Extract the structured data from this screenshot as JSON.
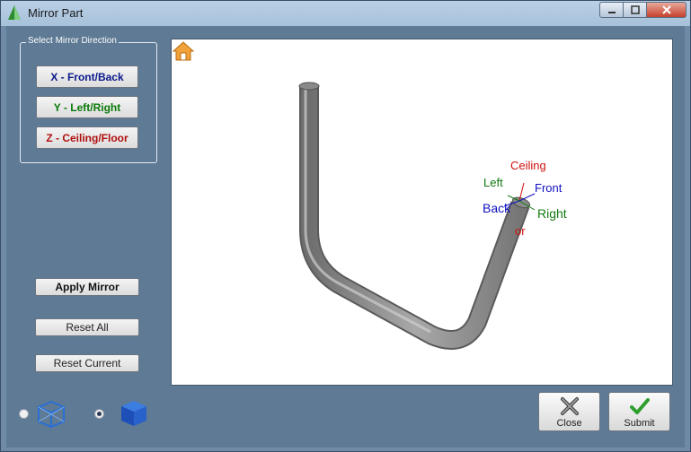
{
  "window": {
    "title": "Mirror Part"
  },
  "mirror_direction": {
    "group_label": "Select Mirror Direction",
    "x_label": "X - Front/Back",
    "y_label": "Y - Left/Right",
    "z_label": "Z - Ceiling/Floor"
  },
  "actions": {
    "apply_label": "Apply Mirror",
    "reset_all_label": "Reset All",
    "reset_current_label": "Reset Current"
  },
  "view_mode": {
    "options": [
      {
        "icon": "wireframe-cube-icon",
        "selected": false
      },
      {
        "icon": "solid-cube-icon",
        "selected": true
      }
    ]
  },
  "viewport": {
    "axis_labels": {
      "ceiling": "Ceiling",
      "left": "Left",
      "front": "Front",
      "back": "Back",
      "right": "Right",
      "floor": "or"
    }
  },
  "footer": {
    "close_label": "Close",
    "submit_label": "Submit"
  },
  "colors": {
    "x_axis": "#1010c0",
    "y_axis": "#107a10",
    "z_axis": "#d01010",
    "panel_bg": "#5e7a94"
  }
}
